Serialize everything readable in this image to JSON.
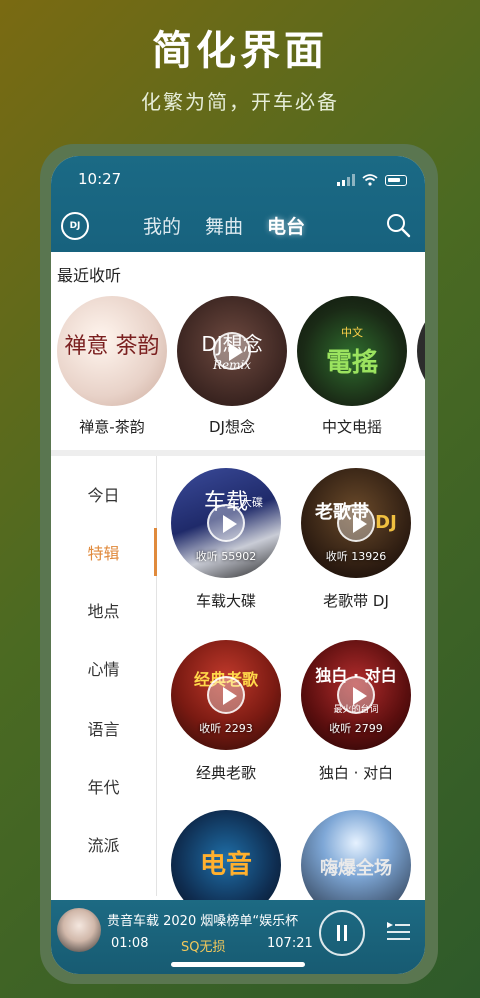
{
  "promo": {
    "title": "简化界面",
    "subtitle": "化繁为简，开车必备"
  },
  "status_bar": {
    "time": "10:27"
  },
  "header": {
    "logo_text": "DJ",
    "tabs": [
      {
        "label": "我的",
        "active": false
      },
      {
        "label": "舞曲",
        "active": false
      },
      {
        "label": "电台",
        "active": true
      }
    ]
  },
  "recent": {
    "title": "最近收听",
    "items": [
      {
        "label": "禅意-茶韵",
        "cover_text": "禅意 茶韵"
      },
      {
        "label": "DJ想念",
        "cover_text": "DJ想念",
        "cover_sub": "Remix"
      },
      {
        "label": "中文电摇",
        "cover_top": "中文",
        "cover_text": "電搖"
      }
    ]
  },
  "sidebar": {
    "items": [
      {
        "label": "今日",
        "active": false
      },
      {
        "label": "特辑",
        "active": true
      },
      {
        "label": "地点",
        "active": false
      },
      {
        "label": "心情",
        "active": false
      },
      {
        "label": "语言",
        "active": false
      },
      {
        "label": "年代",
        "active": false
      },
      {
        "label": "流派",
        "active": false
      }
    ]
  },
  "grid": [
    {
      "label": "车载大碟",
      "listen": "收听 55902",
      "cover_text": "车载",
      "cover_sub": "大碟"
    },
    {
      "label": "老歌带 DJ",
      "listen": "收听 13926",
      "cover_text": "老歌带",
      "cover_sub": "DJ"
    },
    {
      "label": "经典老歌",
      "listen": "收听 2293",
      "cover_text": "经典老歌"
    },
    {
      "label": "独白 · 对白",
      "listen": "收听 2799",
      "cover_text": "独白 · 对白",
      "cover_sub": "最火的台词"
    },
    {
      "label": "",
      "listen": "",
      "cover_text": "电音"
    },
    {
      "label": "",
      "listen": "",
      "cover_text": "嗨爆全场"
    }
  ],
  "player": {
    "title": "贵音车载 2020 烟嗓榜单“娱乐杯",
    "elapsed": "01:08",
    "quality": "SQ无损",
    "total": "107:21"
  },
  "colors": {
    "header": "#17627e",
    "accent": "#e08a3c",
    "quality": "#f2c85b"
  }
}
